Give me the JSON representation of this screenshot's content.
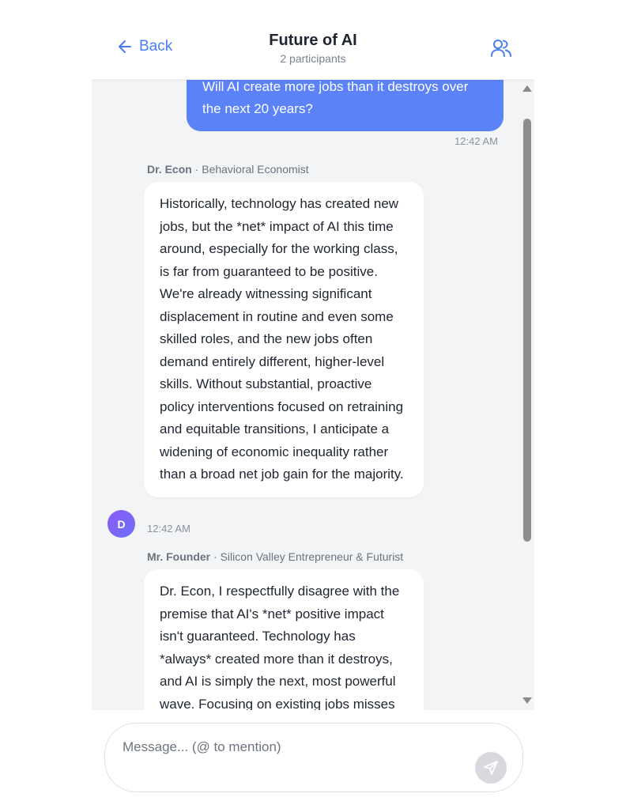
{
  "header": {
    "back_label": "Back",
    "title": "Future of AI",
    "subtitle": "2 participants"
  },
  "messages": [
    {
      "role": "user",
      "text": "Will AI create more jobs than it destroys over the next 20 years?",
      "time": "12:42 AM"
    },
    {
      "role": "participant",
      "sender": "Dr. Econ",
      "sender_role": " · Behavioral Economist",
      "avatar_initial": "D",
      "text": "Historically, technology has created new jobs, but the *net* impact of AI this time around, especially for the working class, is far from guaranteed to be positive. We're already witnessing significant displacement in routine and even some skilled roles, and the new jobs often demand entirely different, higher-level skills. Without substantial, proactive policy interventions focused on retraining and equitable transitions, I anticipate a widening of economic inequality rather than a broad net job gain for the majority.",
      "time": "12:42 AM"
    },
    {
      "role": "participant",
      "sender": "Mr. Founder",
      "sender_role": " · Silicon Valley Entrepreneur & Futurist",
      "text": "Dr. Econ, I respectfully disagree with the premise that AI's *net* positive impact isn't guaranteed. Technology has *always* created more than it destroys, and AI is simply the next, most powerful wave. Focusing on existing jobs misses"
    }
  ],
  "composer": {
    "placeholder": "Message... (@ to mention)"
  },
  "colors": {
    "accent": "#5b82f6",
    "link": "#4a7ef0",
    "chat_background": "#f3f4f6",
    "avatar": "#7c65f6"
  }
}
